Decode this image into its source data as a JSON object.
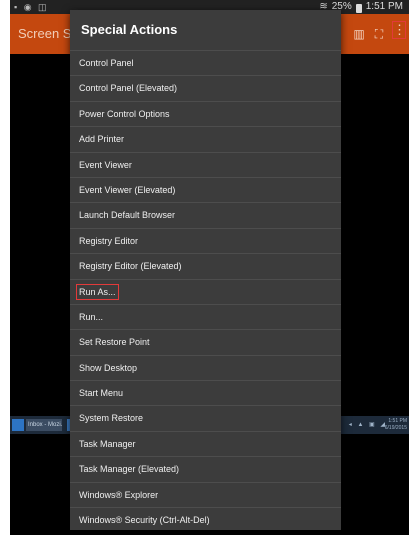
{
  "statusbar": {
    "left_icons": "▪ ◉ ◫",
    "wifi_icon": "wifi-icon",
    "battery_percent": "25%",
    "time": "1:51 PM"
  },
  "app": {
    "title": "Screen Sh",
    "accent": "#c4480f"
  },
  "taskbar": {
    "task1_label": "Inbox - Mozi...",
    "clock_line1": "1:51 PM",
    "clock_line2": "6/19/2015"
  },
  "menu": {
    "title": "Special Actions",
    "items": [
      {
        "label": "Control Panel"
      },
      {
        "label": "Control Panel (Elevated)"
      },
      {
        "label": "Power Control Options"
      },
      {
        "label": "Add Printer"
      },
      {
        "label": "Event Viewer"
      },
      {
        "label": "Event Viewer (Elevated)"
      },
      {
        "label": "Launch Default Browser"
      },
      {
        "label": "Registry Editor"
      },
      {
        "label": "Registry Editor (Elevated)"
      },
      {
        "label": "Run As...",
        "highlighted": true
      },
      {
        "label": "Run..."
      },
      {
        "label": "Set Restore Point"
      },
      {
        "label": "Show Desktop"
      },
      {
        "label": "Start Menu"
      },
      {
        "label": "System Restore"
      },
      {
        "label": "Task Manager"
      },
      {
        "label": "Task Manager (Elevated)"
      },
      {
        "label": "Windows® Explorer"
      },
      {
        "label": "Windows® Security (Ctrl-Alt-Del)"
      }
    ]
  }
}
